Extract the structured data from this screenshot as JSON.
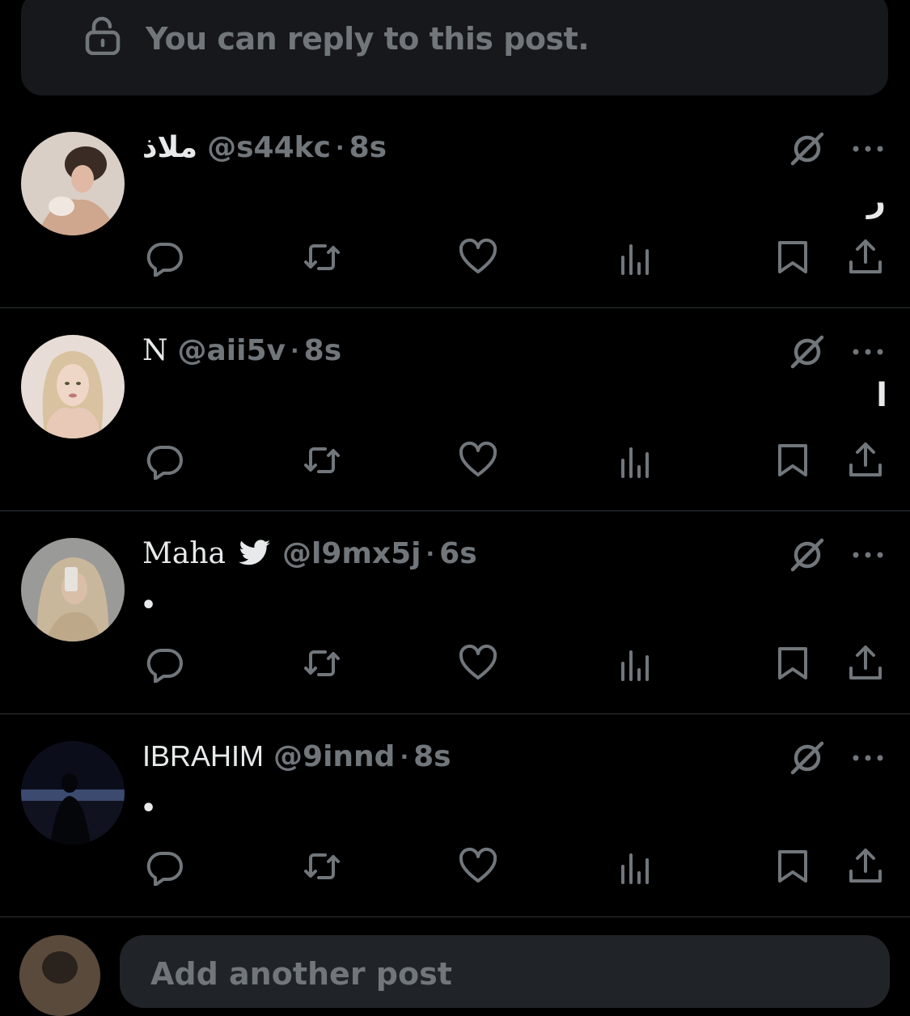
{
  "reply_banner": {
    "text": "You can reply to this post.",
    "icon": "lock-open-icon"
  },
  "posts": [
    {
      "name": "ملاذ",
      "handle": "@s44kc",
      "dot": "·",
      "time": "8s",
      "body": "ر",
      "verified": false
    },
    {
      "name": "N",
      "handle": "@aii5v",
      "dot": "·",
      "time": "8s",
      "body": "ا",
      "verified": false
    },
    {
      "name": "Maha",
      "handle": "@l9mx5j",
      "dot": "·",
      "time": "6s",
      "body": "•",
      "verified": true
    },
    {
      "name": "IBRAHIM",
      "handle": "@9innd",
      "dot": "·",
      "time": "8s",
      "body": "•",
      "verified": false
    }
  ],
  "actions": [
    "reply-icon",
    "repost-icon",
    "like-icon",
    "views-icon",
    "bookmark-icon",
    "share-icon"
  ],
  "composer": {
    "placeholder": "Add another post"
  },
  "colors": {
    "background": "#000000",
    "muted": "#71767b",
    "text": "#e7e9ea",
    "divider": "#2f3336"
  }
}
